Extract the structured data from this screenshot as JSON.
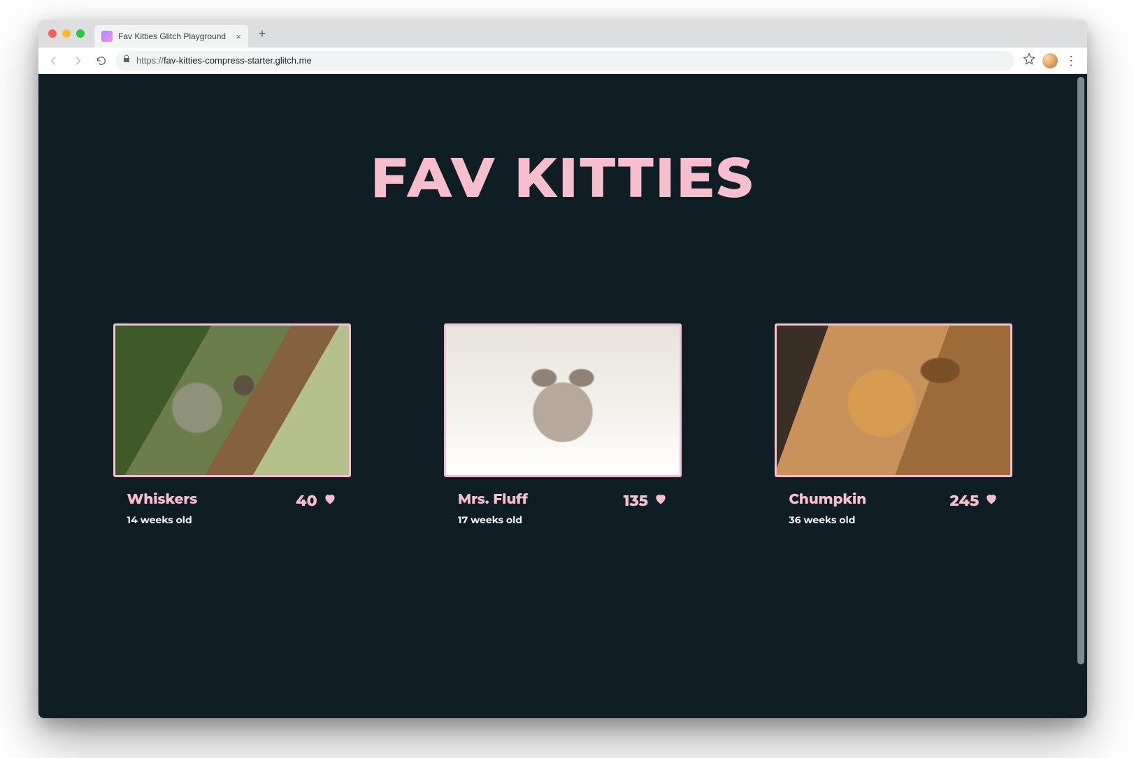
{
  "browser": {
    "tab_title": "Fav Kitties Glitch Playground",
    "url_proto": "https://",
    "url_host": "fav-kitties-compress-starter.glitch.me"
  },
  "page": {
    "title": "FAV KITTIES"
  },
  "cats": [
    {
      "name": "Whiskers",
      "age": "14 weeks old",
      "likes": "40"
    },
    {
      "name": "Mrs. Fluff",
      "age": "17 weeks old",
      "likes": "135"
    },
    {
      "name": "Chumpkin",
      "age": "36 weeks old",
      "likes": "245"
    }
  ],
  "colors": {
    "bg": "#0f1d24",
    "accent": "#f7bfce"
  }
}
